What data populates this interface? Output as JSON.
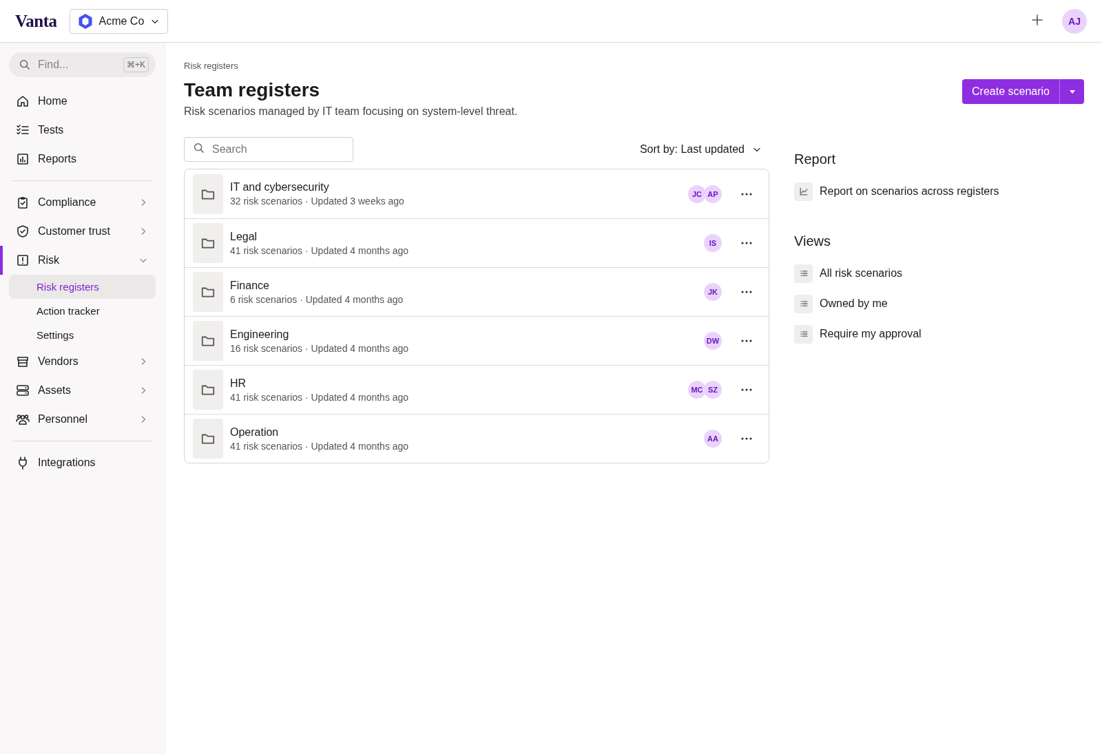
{
  "header": {
    "logo": "Vanta",
    "workspace": "Acme Co",
    "avatar": "AJ"
  },
  "sidebar": {
    "search": {
      "placeholder": "Find...",
      "shortcut": "⌘+K"
    },
    "sections": [
      [
        {
          "kind": "home",
          "label": "Home",
          "selected": false
        },
        {
          "kind": "tests",
          "label": "Tests",
          "selected": false
        },
        {
          "kind": "reports",
          "label": "Reports",
          "selected": false
        }
      ],
      [
        {
          "kind": "compliance",
          "label": "Compliance",
          "selected": false,
          "expanded": false
        },
        {
          "kind": "trust",
          "label": "Customer trust",
          "selected": false,
          "expanded": false
        },
        {
          "kind": "risk",
          "label": "Risk",
          "selected": true,
          "expanded": true,
          "children": [
            {
              "label": "Risk registers",
              "selected": true
            },
            {
              "label": "Action tracker",
              "selected": false
            },
            {
              "label": "Settings",
              "selected": false
            }
          ]
        },
        {
          "kind": "vendors",
          "label": "Vendors",
          "selected": false,
          "expanded": false
        },
        {
          "kind": "assets",
          "label": "Assets",
          "selected": false,
          "expanded": false
        },
        {
          "kind": "personnel",
          "label": "Personnel",
          "selected": false,
          "expanded": false
        }
      ],
      [
        {
          "kind": "integrations",
          "label": "Integrations",
          "selected": false
        }
      ]
    ]
  },
  "page": {
    "breadcrumb": "Risk registers",
    "title": "Team registers",
    "description": "Risk scenarios managed by IT team focusing on system-level threat.",
    "primary_button": "Create scenario",
    "search": {
      "placeholder": "Search"
    },
    "sort": "Sort by: Last updated",
    "registers": [
      {
        "name": "IT and cybersecurity",
        "meta": "32 risk scenarios · Updated 3 weeks ago",
        "owners": [
          "JC",
          "AP"
        ]
      },
      {
        "name": "Legal",
        "meta": "41 risk scenarios · Updated 4 months ago",
        "owners": [
          "IS"
        ]
      },
      {
        "name": "Finance",
        "meta": "6 risk scenarios · Updated 4 months ago",
        "owners": [
          "JK"
        ]
      },
      {
        "name": "Engineering",
        "meta": "16 risk scenarios · Updated 4 months ago",
        "owners": [
          "DW"
        ]
      },
      {
        "name": "HR",
        "meta": "41 risk scenarios · Updated 4 months ago",
        "owners": [
          "MC",
          "SZ"
        ]
      },
      {
        "name": "Operation",
        "meta": "41 risk scenarios · Updated 4 months ago",
        "owners": [
          "AA"
        ]
      }
    ]
  },
  "aside": {
    "report": {
      "heading": "Report",
      "links": [
        {
          "kind": "chart",
          "label": "Report on scenarios across registers"
        }
      ]
    },
    "views": {
      "heading": "Views",
      "links": [
        {
          "kind": "list",
          "label": "All risk scenarios"
        },
        {
          "kind": "list",
          "label": "Owned by me"
        },
        {
          "kind": "list",
          "label": "Require my approval"
        }
      ]
    }
  }
}
